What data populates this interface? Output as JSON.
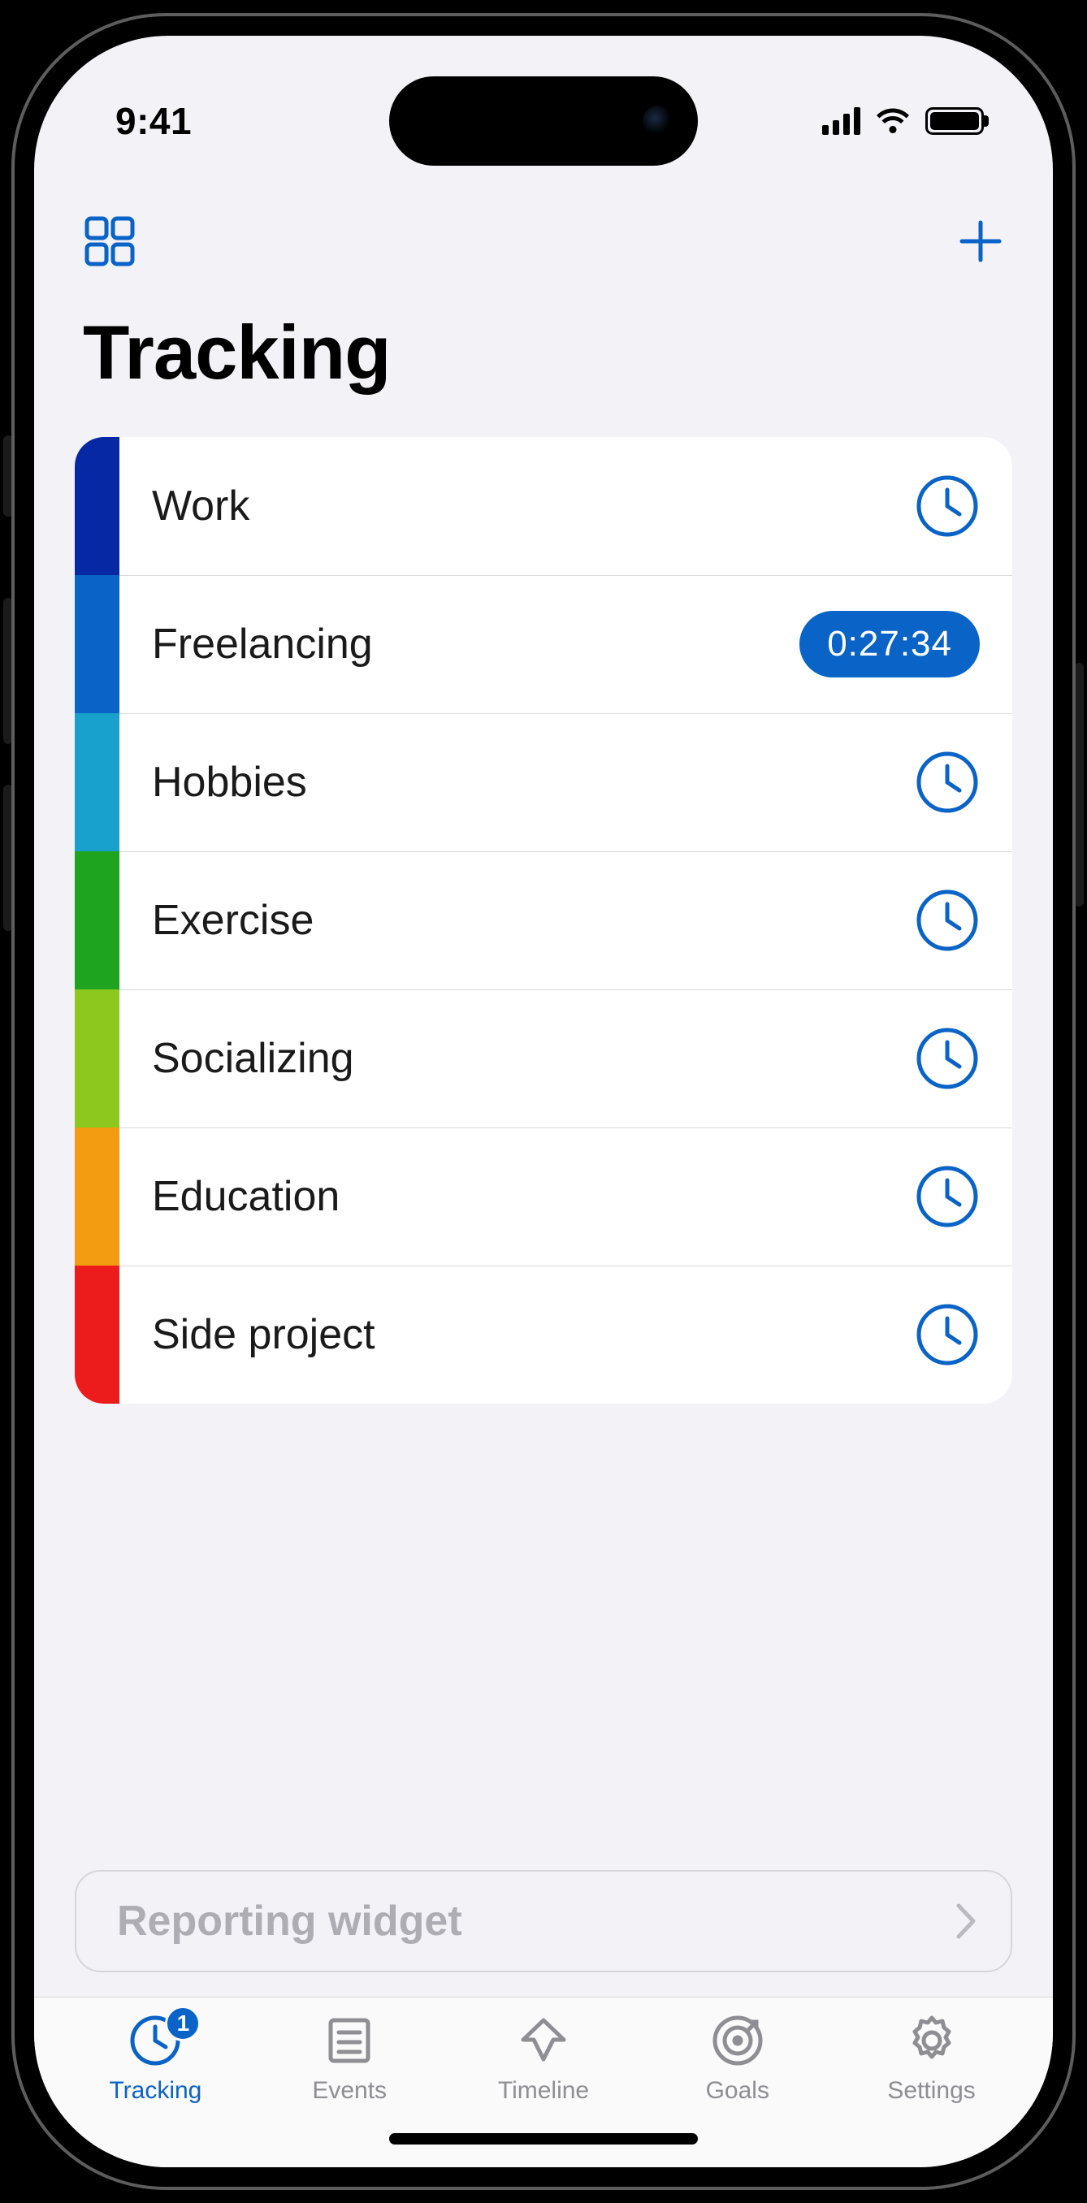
{
  "status": {
    "time": "9:41"
  },
  "header": {
    "title": "Tracking"
  },
  "trackers": [
    {
      "label": "Work",
      "color": "#0728a5",
      "running": false,
      "timer": ""
    },
    {
      "label": "Freelancing",
      "color": "#0a63c7",
      "running": true,
      "timer": "0:27:34"
    },
    {
      "label": "Hobbies",
      "color": "#18a1cc",
      "running": false,
      "timer": ""
    },
    {
      "label": "Exercise",
      "color": "#1ea41e",
      "running": false,
      "timer": ""
    },
    {
      "label": "Socializing",
      "color": "#8dc81e",
      "running": false,
      "timer": ""
    },
    {
      "label": "Education",
      "color": "#f39b11",
      "running": false,
      "timer": ""
    },
    {
      "label": "Side project",
      "color": "#ec1c1c",
      "running": false,
      "timer": ""
    }
  ],
  "reporting": {
    "label": "Reporting widget"
  },
  "tabs": [
    {
      "id": "tracking",
      "label": "Tracking",
      "active": true,
      "badge": "1"
    },
    {
      "id": "events",
      "label": "Events",
      "active": false,
      "badge": ""
    },
    {
      "id": "timeline",
      "label": "Timeline",
      "active": false,
      "badge": ""
    },
    {
      "id": "goals",
      "label": "Goals",
      "active": false,
      "badge": ""
    },
    {
      "id": "settings",
      "label": "Settings",
      "active": false,
      "badge": ""
    }
  ]
}
